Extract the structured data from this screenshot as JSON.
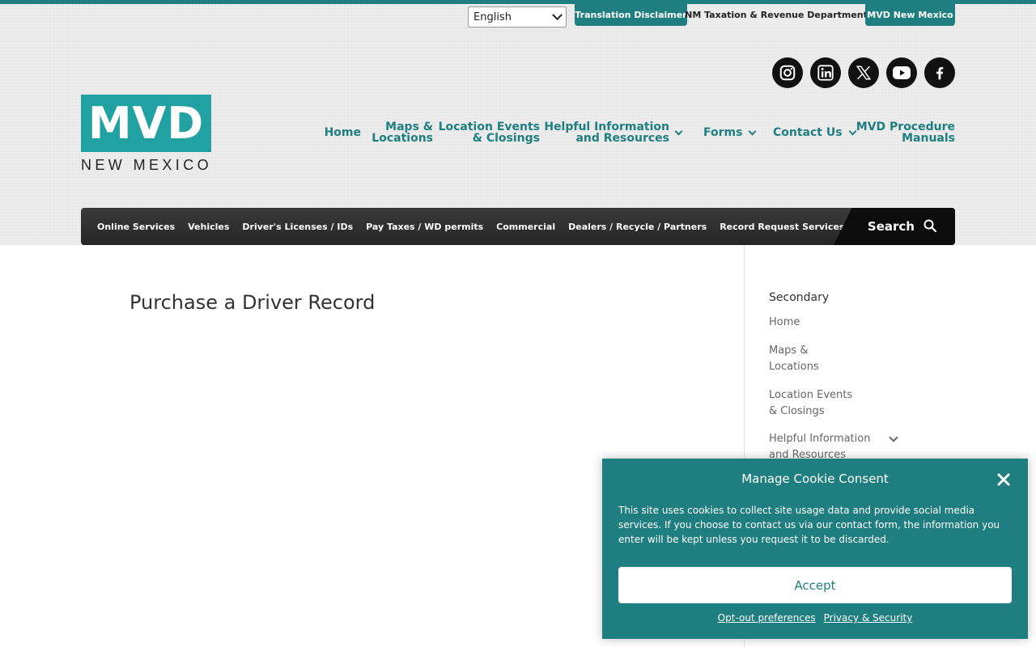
{
  "top_bar": {
    "language": {
      "selected": "English"
    },
    "links": [
      "Translation Disclaimer",
      "NM Taxation & Revenue Department",
      "MVD New Mexico"
    ]
  },
  "social": [
    "instagram-icon",
    "linkedin-icon",
    "x-icon",
    "youtube-icon",
    "facebook-icon"
  ],
  "logo": {
    "main": "MVD",
    "sub": "NEW MEXICO"
  },
  "main_nav": {
    "home": "Home",
    "maps_1": "Maps &",
    "maps_2": "Locations",
    "events_1": "Location Events",
    "events_2": "& Closings",
    "helpful_1": "Helpful Information",
    "helpful_2": "and Resources",
    "forms": "Forms",
    "contact": "Contact Us",
    "manuals_1": "MVD Procedure",
    "manuals_2": "Manuals"
  },
  "sub_nav": {
    "items": [
      "Online Services",
      "Vehicles",
      "Driver's Licenses / IDs",
      "Pay Taxes / WD permits",
      "Commercial",
      "Dealers / Recycle / Partners",
      "Record Request Services"
    ],
    "search_label": "Search"
  },
  "main": {
    "title": "Purchase a Driver Record"
  },
  "sidebar": {
    "title": "Secondary",
    "home": "Home",
    "maps_1": "Maps &",
    "maps_2": "Locations",
    "events_1": "Location Events",
    "events_2": "& Closings",
    "helpful_1": "Helpful Information",
    "helpful_2": "and Resources"
  },
  "cookie": {
    "title": "Manage Cookie Consent",
    "body": "This site uses cookies to collect site usage data and provide social media services. If you choose to contact us via our contact form, the information you enter will be kept unless you request it to be discarded.",
    "accept": "Accept",
    "opt_out": "Opt-out preferences",
    "privacy": "Privacy & Security"
  },
  "colors": {
    "brand_teal": "#1f7f80",
    "logo_teal": "#21a1a1",
    "subnav_dark": "#2e2e2e"
  }
}
